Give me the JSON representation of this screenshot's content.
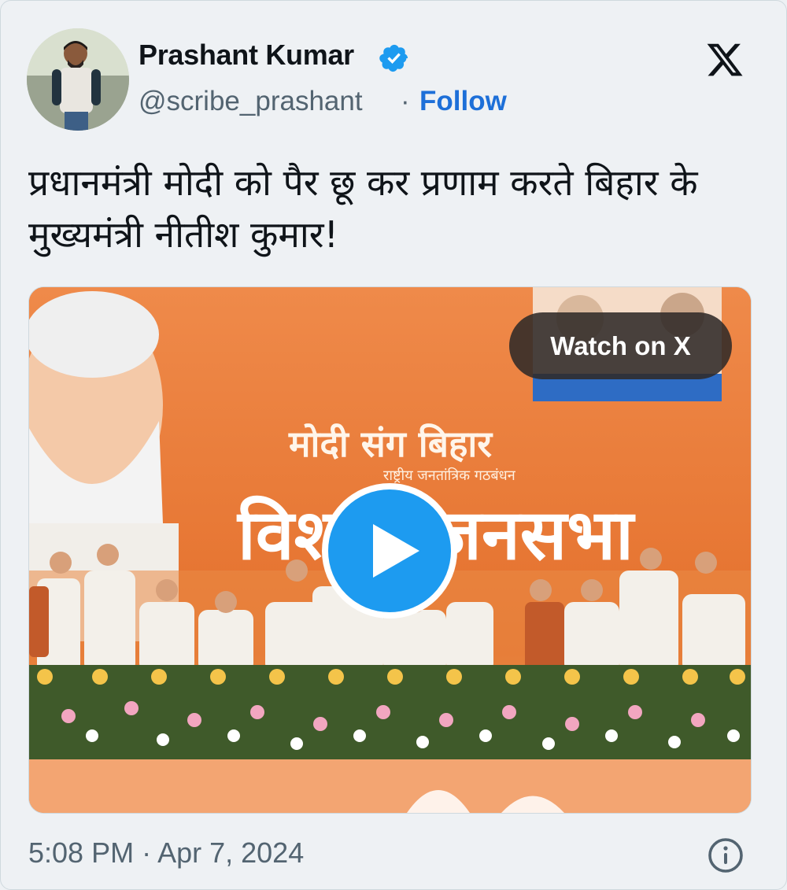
{
  "author": {
    "name": "Prashant Kumar",
    "handle": "@scribe_prashant",
    "separator": "·",
    "follow_label": "Follow",
    "verified_color": "#1d9bf0"
  },
  "tweet": {
    "text": "प्रधानमंत्री मोदी को पैर छू कर प्रणाम करते बिहार के मुख्यमंत्री नीतीश कुमार!",
    "timestamp": "5:08 PM · Apr 7, 2024"
  },
  "media": {
    "watch_label": "Watch on X",
    "banner_title": "मोदी संग बिहार",
    "banner_subtitle": "राष्ट्रीय जनतांत्रिक गठबंधन",
    "banner_main": "विशाल जनसभा",
    "play_color": "#1d9bf0"
  },
  "icons": {
    "brand": "x-logo-icon",
    "verified": "verified-badge-icon",
    "play": "play-icon",
    "info": "info-icon"
  }
}
